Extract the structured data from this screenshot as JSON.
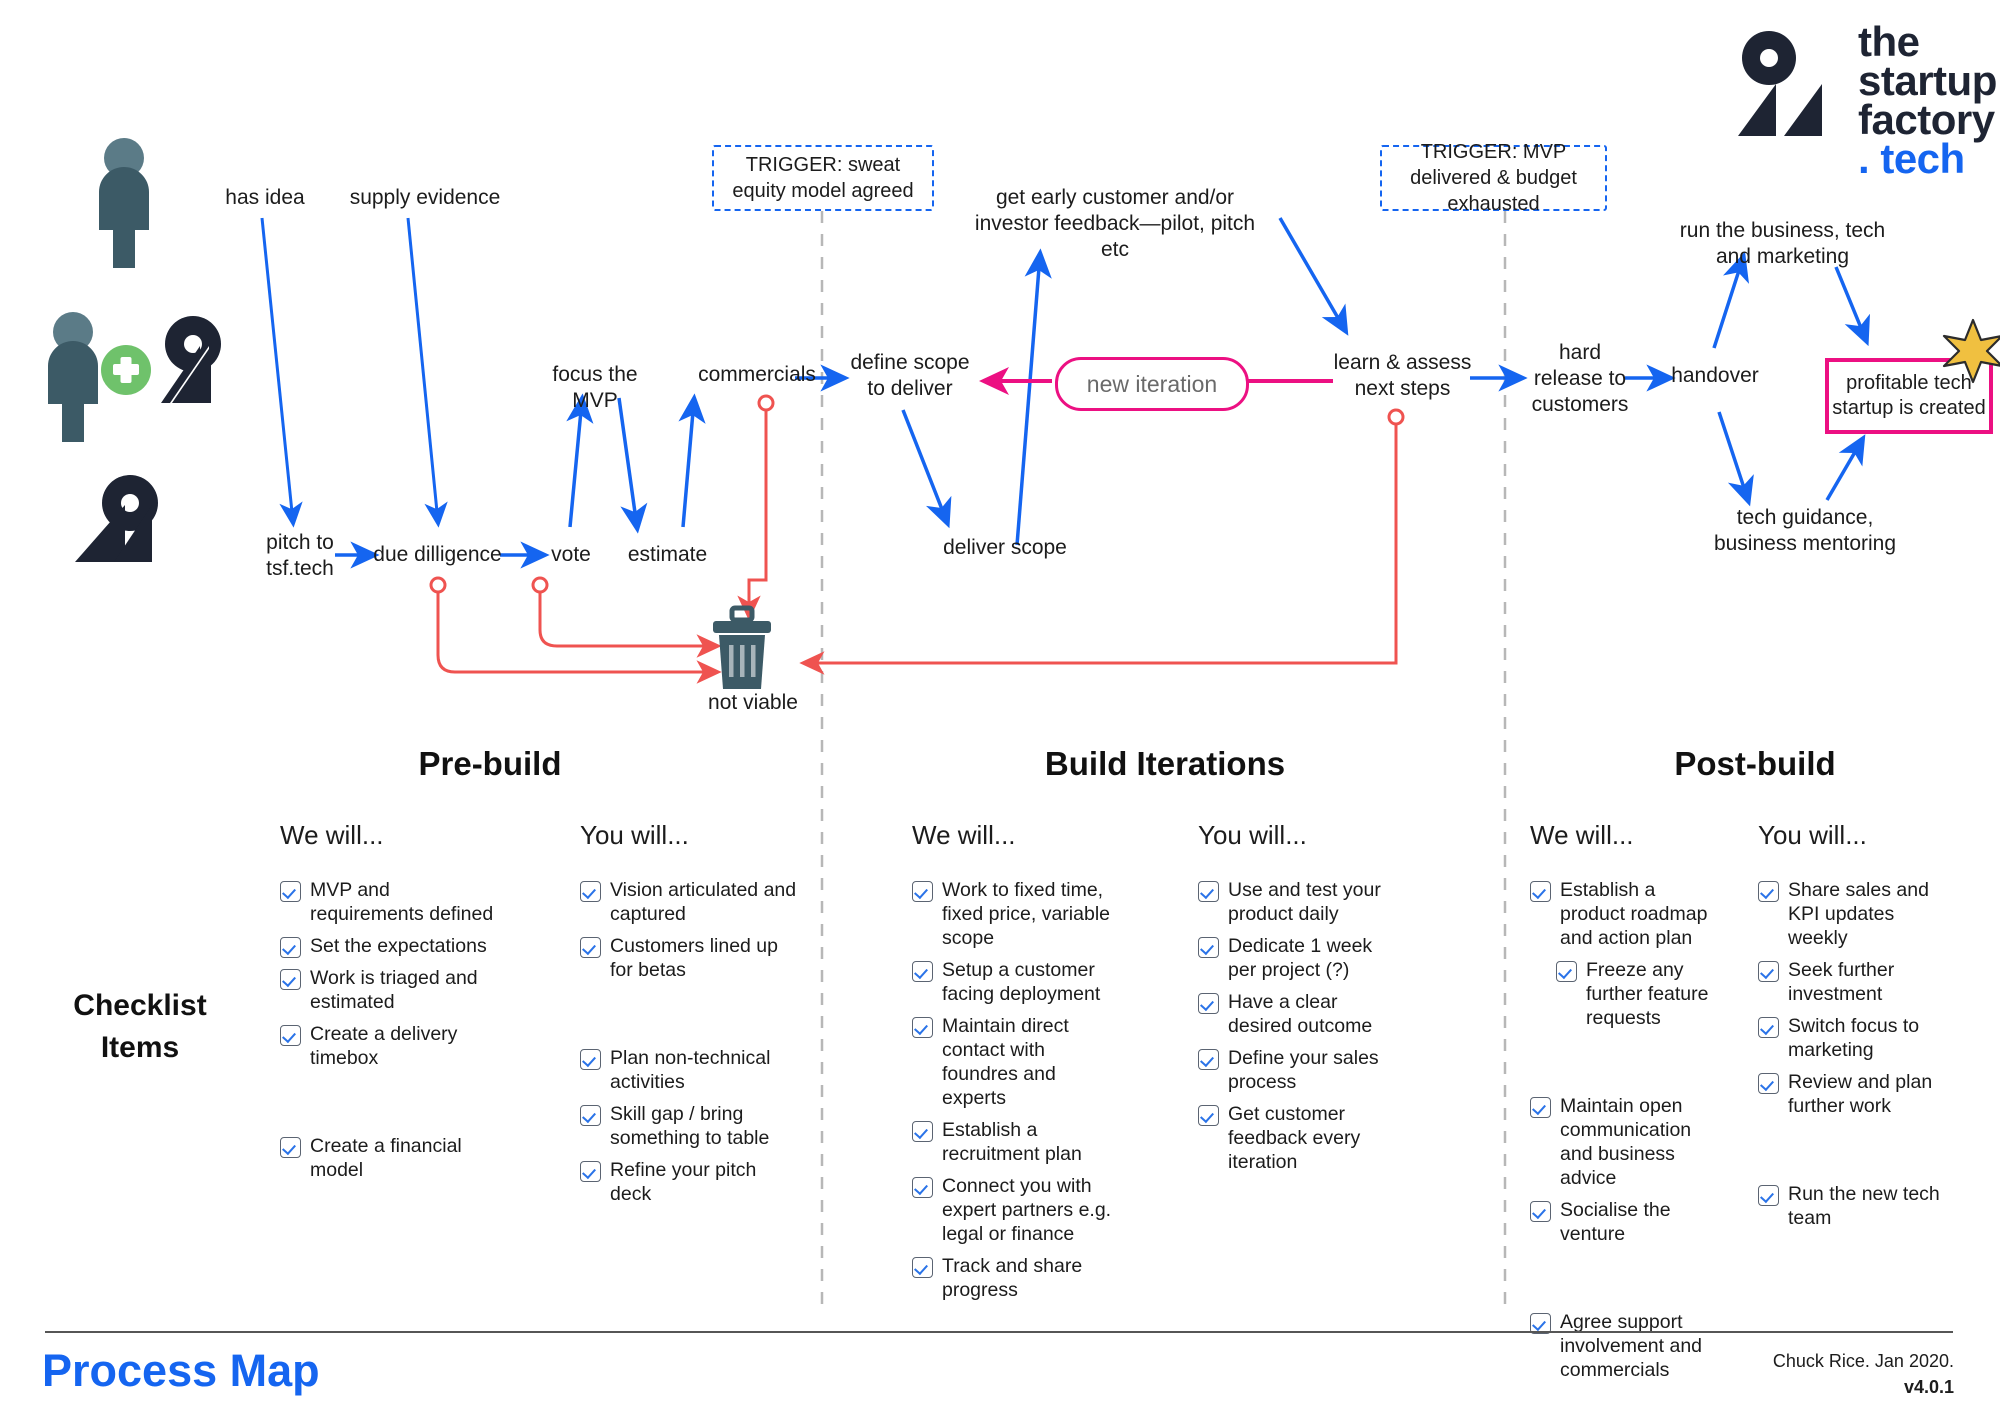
{
  "logo": {
    "line1": "the",
    "line2": "startup",
    "line3": "factory",
    "line4": ". tech"
  },
  "colors": {
    "blue_arrow": "#1565f0",
    "red_arrow": "#ef5350",
    "pink": "#ec1082",
    "slate": "#3c5a66",
    "dark": "#1e2433",
    "green": "#6fc26b",
    "gold": "#f0c040",
    "divider": "#b7b7b7"
  },
  "flow": {
    "labels": {
      "has_idea": "has idea",
      "supply_evidence": "supply evidence",
      "pitch": "pitch to\ntsf.tech",
      "due_diligence": "due dilligence",
      "vote": "vote",
      "estimate": "estimate",
      "focus_mvp": "focus the MVP",
      "commercials": "commercials",
      "not_viable": "not viable",
      "define_scope": "define scope\nto deliver",
      "deliver_scope": "deliver scope",
      "early_feedback": "get early customer and/or\ninvestor feedback—pilot, pitch etc",
      "new_iteration": "new iteration",
      "learn_assess": "learn & assess\nnext steps",
      "hard_release": "hard\nrelease to\ncustomers",
      "handover": "handover",
      "run_business": "run the business, tech\nand marketing",
      "tech_guidance": "tech guidance,\nbusiness mentoring",
      "outcome": "profitable tech\nstartup is created"
    },
    "triggers": [
      {
        "text": "TRIGGER: sweat equity\nmodel agreed"
      },
      {
        "text": "TRIGGER: MVP delivered\n& budget exhausted"
      }
    ]
  },
  "checklist": {
    "row_label": "Checklist\nItems",
    "we_will": "We will...",
    "you_will": "You will...",
    "sections": [
      {
        "title": "Pre-build",
        "we_will": [
          {
            "text": "MVP and requirements defined",
            "indent": false,
            "gap": false
          },
          {
            "text": "Set the expectations",
            "indent": false,
            "gap": false
          },
          {
            "text": "Work is triaged and estimated",
            "indent": false,
            "gap": false
          },
          {
            "text": "Create a delivery timebox",
            "indent": false,
            "gap": false
          },
          {
            "text": "Create a financial model",
            "indent": false,
            "gap": true
          }
        ],
        "you_will": [
          {
            "text": "Vision articulated and captured",
            "indent": false,
            "gap": false
          },
          {
            "text": "Customers lined up for betas",
            "indent": false,
            "gap": false
          },
          {
            "text": "Plan non-technical activities",
            "indent": false,
            "gap": true
          },
          {
            "text": "Skill gap / bring something to table",
            "indent": false,
            "gap": false
          },
          {
            "text": "Refine your pitch deck",
            "indent": false,
            "gap": false
          }
        ]
      },
      {
        "title": "Build Iterations",
        "we_will": [
          {
            "text": "Work to fixed time, fixed price, variable scope",
            "indent": false,
            "gap": false
          },
          {
            "text": "Setup a customer facing deployment",
            "indent": false,
            "gap": false
          },
          {
            "text": "Maintain direct contact with foundres and experts",
            "indent": false,
            "gap": false
          },
          {
            "text": "Establish a recruitment plan",
            "indent": false,
            "gap": false
          },
          {
            "text": "Connect you with expert partners e.g. legal or finance",
            "indent": false,
            "gap": false
          },
          {
            "text": "Track and share progress",
            "indent": false,
            "gap": false
          }
        ],
        "you_will": [
          {
            "text": "Use and test your product daily",
            "indent": false,
            "gap": false
          },
          {
            "text": "Dedicate 1 week per project (?)",
            "indent": false,
            "gap": false
          },
          {
            "text": "Have a clear desired outcome",
            "indent": false,
            "gap": false
          },
          {
            "text": "Define your sales process",
            "indent": false,
            "gap": false
          },
          {
            "text": "Get customer feedback every iteration",
            "indent": false,
            "gap": false
          }
        ]
      },
      {
        "title": "Post-build",
        "we_will": [
          {
            "text": "Establish a product roadmap and action plan",
            "indent": false,
            "gap": false
          },
          {
            "text": "Freeze any further feature requests",
            "indent": true,
            "gap": false
          },
          {
            "text": "Maintain open communication and business advice",
            "indent": false,
            "gap": true
          },
          {
            "text": "Socialise the venture",
            "indent": false,
            "gap": false
          },
          {
            "text": "Agree support involvement and commercials",
            "indent": false,
            "gap": true
          }
        ],
        "you_will": [
          {
            "text": "Share sales and KPI updates weekly",
            "indent": false,
            "gap": false
          },
          {
            "text": "Seek further investment",
            "indent": false,
            "gap": false
          },
          {
            "text": "Switch focus to marketing",
            "indent": false,
            "gap": false
          },
          {
            "text": "Review and plan further work",
            "indent": false,
            "gap": false
          },
          {
            "text": "Run the new tech team",
            "indent": false,
            "gap": true
          }
        ]
      }
    ]
  },
  "footer": {
    "title": "Process Map",
    "author": "Chuck Rice. Jan 2020.",
    "version": "v4.0.1"
  }
}
